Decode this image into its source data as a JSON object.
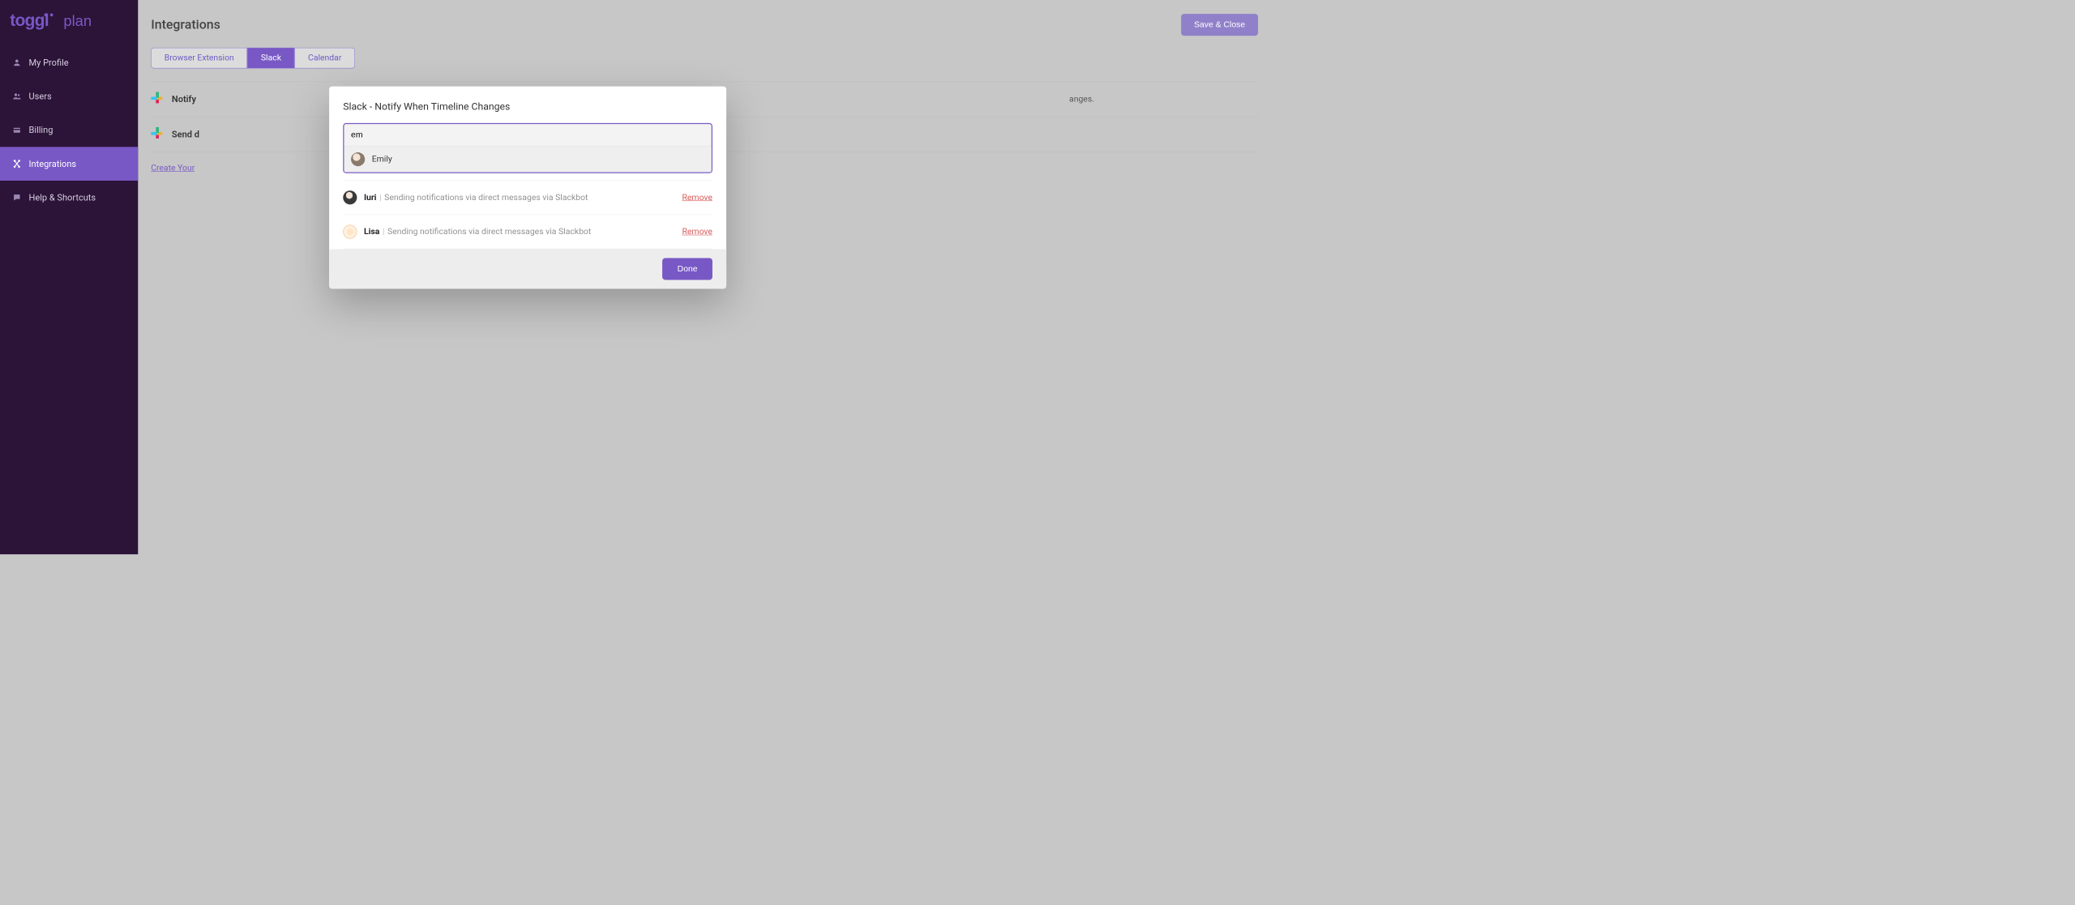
{
  "brand": {
    "name": "toggl plan"
  },
  "sidebar": {
    "items": [
      {
        "label": "My Profile",
        "icon": "user-icon"
      },
      {
        "label": "Users",
        "icon": "users-icon"
      },
      {
        "label": "Billing",
        "icon": "billing-icon"
      },
      {
        "label": "Integrations",
        "icon": "integrations-icon"
      },
      {
        "label": "Help & Shortcuts",
        "icon": "help-icon"
      }
    ]
  },
  "main": {
    "title": "Integrations",
    "save_label": "Save & Close",
    "tabs": {
      "browser": "Browser Extension",
      "slack": "Slack",
      "calendar": "Calendar"
    },
    "rows": {
      "notify_label": "Notify",
      "notify_desc_tail": "anges.",
      "send_label": "Send d"
    },
    "create_link": "Create Your"
  },
  "modal": {
    "title": "Slack - Notify When Timeline Changes",
    "search_value": "em",
    "search_placeholder": "",
    "result": {
      "name": "Emily"
    },
    "users": [
      {
        "name": "Iuri",
        "desc": "Sending notifications via direct messages via Slackbot",
        "remove": "Remove"
      },
      {
        "name": "Lisa",
        "desc": "Sending notifications via direct messages via Slackbot",
        "remove": "Remove"
      }
    ],
    "done_label": "Done"
  }
}
